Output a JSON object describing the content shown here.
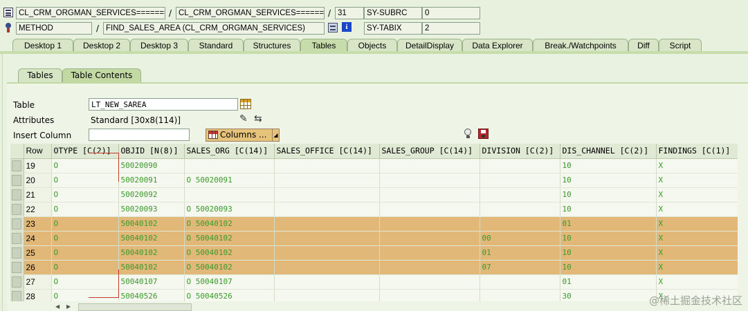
{
  "top": {
    "row1": {
      "program": "CL_CRM_ORGMAN_SERVICES=======...",
      "slash1": "/",
      "include": "CL_CRM_ORGMAN_SERVICES=======...",
      "slash2": "/",
      "line": "31",
      "sysvar": "SY-SUBRC",
      "sysval": "0"
    },
    "row2": {
      "type": "METHOD",
      "slash": "/",
      "name": "FIND_SALES_AREA (CL_CRM_ORGMAN_SERVICES)",
      "sysvar": "SY-TABIX",
      "sysval": "2"
    }
  },
  "tabs": [
    "Desktop 1",
    "Desktop 2",
    "Desktop 3",
    "Standard",
    "Structures",
    "Tables",
    "Objects",
    "DetailDisplay",
    "Data Explorer",
    "Break./Watchpoints",
    "Diff",
    "Script"
  ],
  "subtabs": [
    "Tables",
    "Table Contents"
  ],
  "form": {
    "table_label": "Table",
    "table_value": "LT_NEW_SAREA",
    "attr_label": "Attributes",
    "attr_value": "Standard [30x8(114)]",
    "insert_label": "Insert Column",
    "insert_value": "",
    "columns_button": "Columns ..."
  },
  "grid": {
    "columns": [
      "Row",
      "OTYPE [C(2)]",
      "OBJID [N(8)]",
      "SALES_ORG [C(14)]",
      "SALES_OFFICE [C(14)]",
      "SALES_GROUP [C(14)]",
      "DIVISION [C(2)]",
      "DIS_CHANNEL [C(2)]",
      "FINDINGS [C(1)]"
    ],
    "rows": [
      {
        "row": "19",
        "otype": "O",
        "objid": "50020090",
        "sales_org": "",
        "sales_office": "",
        "sales_group": "",
        "division": "",
        "dis_channel": "10",
        "findings": "X",
        "hl": false
      },
      {
        "row": "20",
        "otype": "O",
        "objid": "50020091",
        "sales_org": "O 50020091",
        "sales_office": "",
        "sales_group": "",
        "division": "",
        "dis_channel": "10",
        "findings": "X",
        "hl": false
      },
      {
        "row": "21",
        "otype": "O",
        "objid": "50020092",
        "sales_org": "",
        "sales_office": "",
        "sales_group": "",
        "division": "",
        "dis_channel": "10",
        "findings": "X",
        "hl": false
      },
      {
        "row": "22",
        "otype": "O",
        "objid": "50020093",
        "sales_org": "O 50020093",
        "sales_office": "",
        "sales_group": "",
        "division": "",
        "dis_channel": "10",
        "findings": "X",
        "hl": false
      },
      {
        "row": "23",
        "otype": "O",
        "objid": "50040102",
        "sales_org": "O 50040102",
        "sales_office": "",
        "sales_group": "",
        "division": "",
        "dis_channel": "01",
        "findings": "X",
        "hl": true
      },
      {
        "row": "24",
        "otype": "O",
        "objid": "50040102",
        "sales_org": "O 50040102",
        "sales_office": "",
        "sales_group": "",
        "division": "00",
        "dis_channel": "10",
        "findings": "X",
        "hl": true
      },
      {
        "row": "25",
        "otype": "O",
        "objid": "50040102",
        "sales_org": "O 50040102",
        "sales_office": "",
        "sales_group": "",
        "division": "01",
        "dis_channel": "10",
        "findings": "X",
        "hl": true
      },
      {
        "row": "26",
        "otype": "O",
        "objid": "50040102",
        "sales_org": "O 50040102",
        "sales_office": "",
        "sales_group": "",
        "division": "07",
        "dis_channel": "10",
        "findings": "X",
        "hl": true
      },
      {
        "row": "27",
        "otype": "O",
        "objid": "50040107",
        "sales_org": "O 50040107",
        "sales_office": "",
        "sales_group": "",
        "division": "",
        "dis_channel": "01",
        "findings": "X",
        "hl": false
      },
      {
        "row": "28",
        "otype": "O",
        "objid": "50040526",
        "sales_org": "O 50040526",
        "sales_office": "",
        "sales_group": "",
        "division": "",
        "dis_channel": "30",
        "findings": "X",
        "hl": false
      }
    ]
  },
  "icons": {
    "program": "program-icon",
    "method": "method-icon",
    "source": "source-icon",
    "info": "info-icon",
    "table_picker": "table-view-icon",
    "attr_edit": "edit-icon",
    "attr_nav": "navigate-icon",
    "lamp": "lamp-icon",
    "save": "save-icon"
  },
  "watermark": "@稀土掘金技术社区"
}
